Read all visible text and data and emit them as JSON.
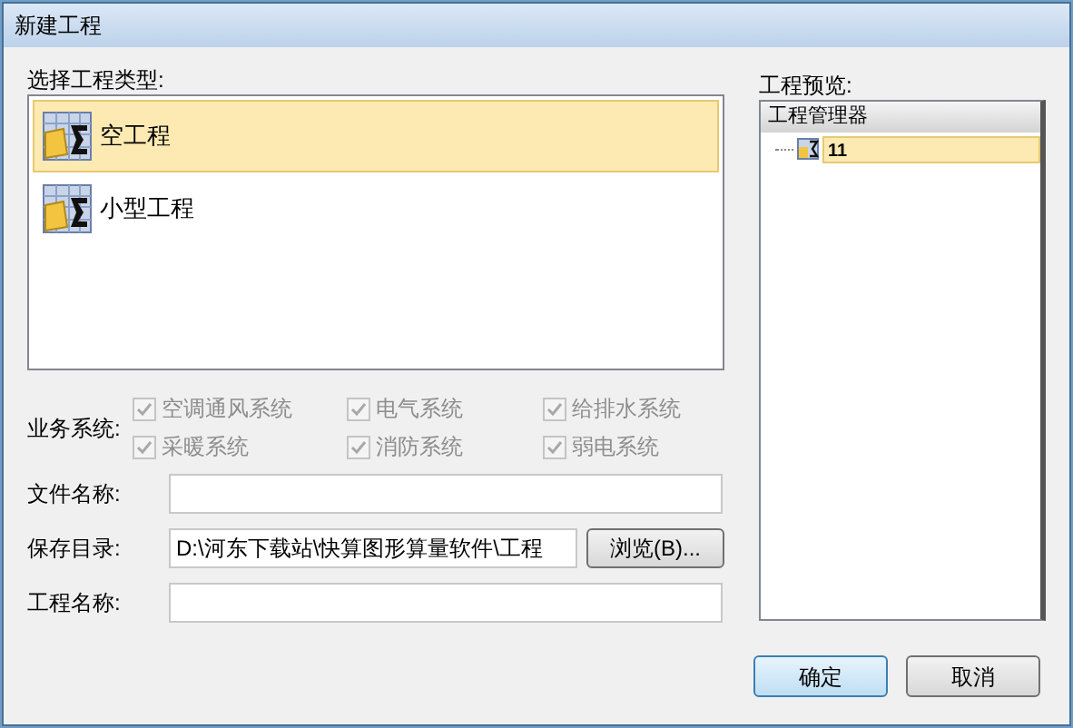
{
  "window": {
    "title": "新建工程"
  },
  "type_list": {
    "label": "选择工程类型:",
    "items": [
      {
        "label": "空工程",
        "selected": true
      },
      {
        "label": "小型工程",
        "selected": false
      }
    ]
  },
  "systems": {
    "label": "业务系统:",
    "options": [
      {
        "label": "空调通风系统",
        "checked": true,
        "disabled": true
      },
      {
        "label": "电气系统",
        "checked": true,
        "disabled": true
      },
      {
        "label": "给排水系统",
        "checked": true,
        "disabled": true
      },
      {
        "label": "采暖系统",
        "checked": true,
        "disabled": true
      },
      {
        "label": "消防系统",
        "checked": true,
        "disabled": true
      },
      {
        "label": "弱电系统",
        "checked": true,
        "disabled": true
      }
    ]
  },
  "file_name": {
    "label": "文件名称:"
  },
  "save_dir": {
    "label": "保存目录:",
    "value": "D:\\河东下载站\\快算图形算量软件\\工程",
    "browse": "浏览(B)..."
  },
  "project_name": {
    "label": "工程名称:"
  },
  "preview": {
    "label": "工程预览:",
    "header": "工程管理器",
    "items": [
      {
        "label": "11",
        "selected": true
      }
    ]
  },
  "buttons": [
    {
      "label": "确定",
      "default": true
    },
    {
      "label": "取消",
      "default": false
    }
  ]
}
